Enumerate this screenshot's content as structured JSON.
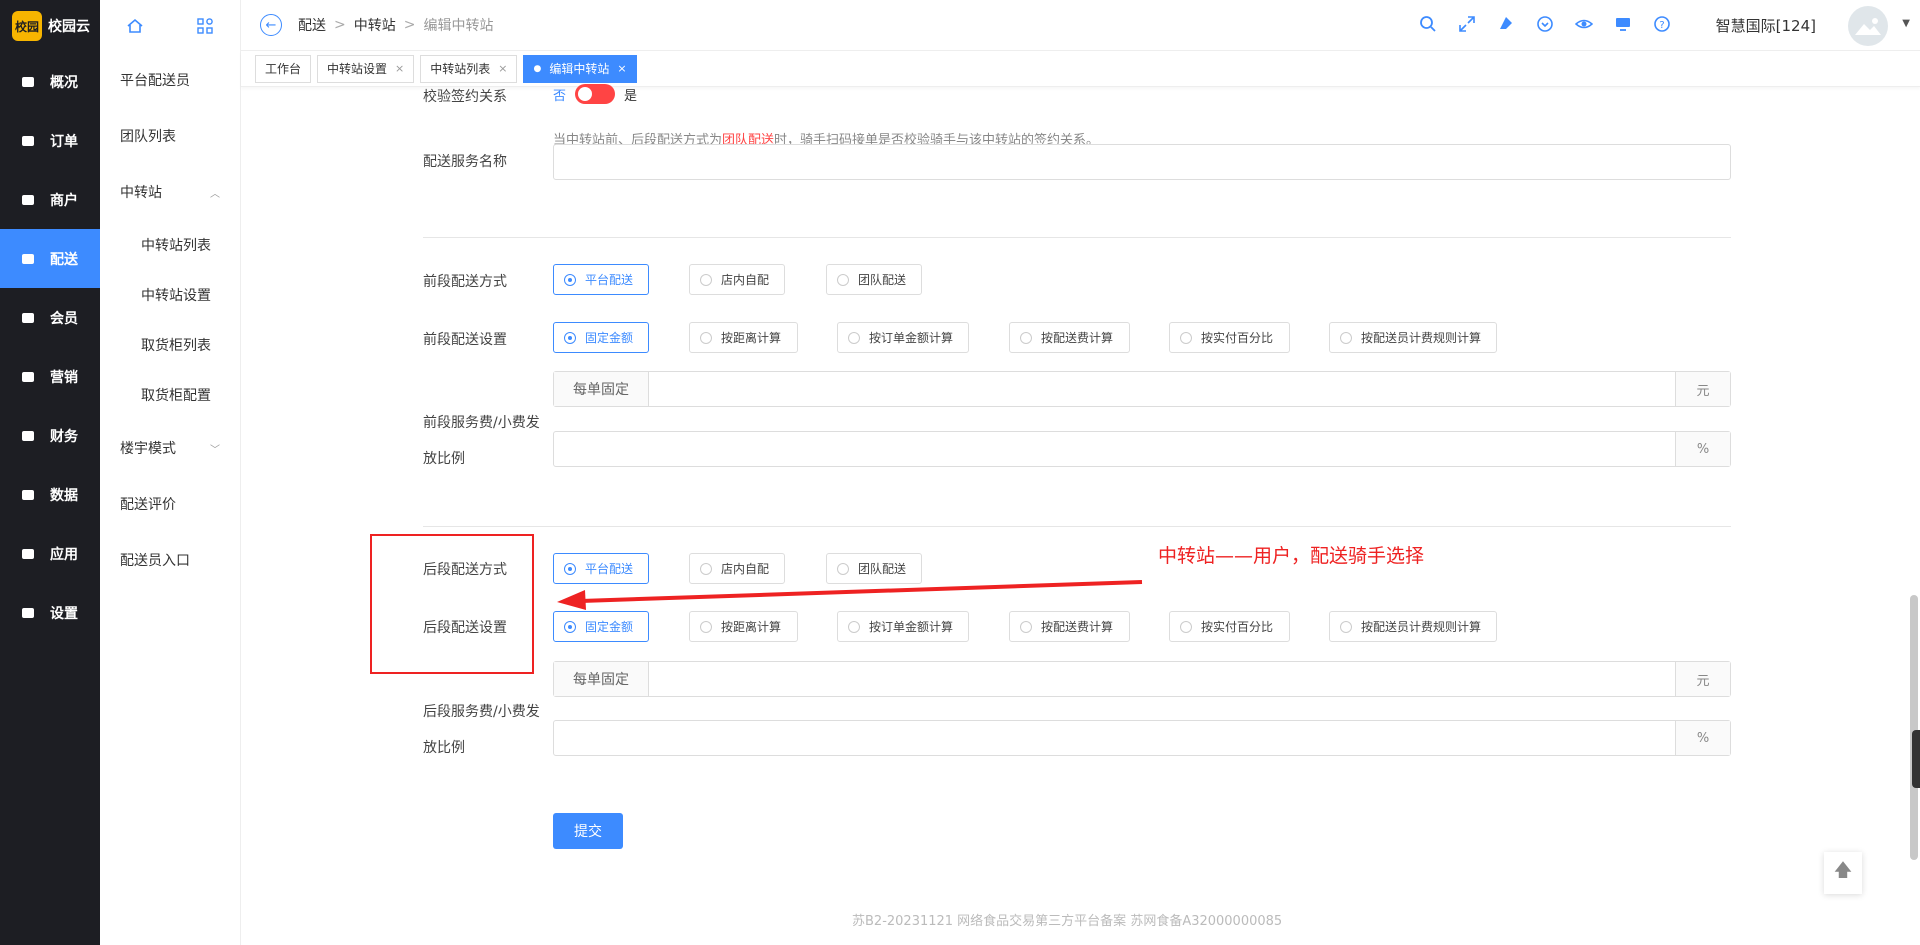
{
  "brand": {
    "badge": "校园",
    "name": "校园云"
  },
  "nav": [
    {
      "label": "概况",
      "icon": "overview-icon"
    },
    {
      "label": "订单",
      "icon": "order-icon"
    },
    {
      "label": "商户",
      "icon": "store-icon"
    },
    {
      "label": "配送",
      "icon": "delivery-icon",
      "active": true
    },
    {
      "label": "会员",
      "icon": "member-icon"
    },
    {
      "label": "营销",
      "icon": "marketing-icon"
    },
    {
      "label": "财务",
      "icon": "finance-icon"
    },
    {
      "label": "数据",
      "icon": "data-icon"
    },
    {
      "label": "应用",
      "icon": "app-icon"
    },
    {
      "label": "设置",
      "icon": "settings-icon"
    }
  ],
  "subnav": {
    "items": [
      "平台配送员",
      "团队列表",
      "中转站",
      "中转站列表",
      "中转站设置",
      "取货柜列表",
      "取货柜配置",
      "楼宇模式",
      "配送评价",
      "配送员入口"
    ]
  },
  "breadcrumb": [
    "配送",
    "中转站",
    "编辑中转站"
  ],
  "user": {
    "name": "智慧国际[124]"
  },
  "tabs": [
    {
      "label": "工作台"
    },
    {
      "label": "中转站设置"
    },
    {
      "label": "中转站列表"
    },
    {
      "label": "编辑中转站",
      "active": true
    }
  ],
  "form": {
    "verify_label": "校验签约关系",
    "switch_no": "否",
    "switch_yes": "是",
    "hint_pre": "当中转站前、后段配送方式为",
    "hint_red": "团队配送",
    "hint_post": "时，骑手扫码接单是否校验骑手与该中转站的签约关系。",
    "service_name_label": "配送服务名称",
    "front_mode_label": "前段配送方式",
    "front_set_label": "前段配送设置",
    "front_fee_label_1": "前段服务费/小费发",
    "front_fee_label_2": "放比例",
    "back_mode_label": "后段配送方式",
    "back_set_label": "后段配送设置",
    "back_fee_label_1": "后段服务费/小费发",
    "back_fee_label_2": "放比例",
    "mode_options": [
      "平台配送",
      "店内自配",
      "团队配送"
    ],
    "set_options": [
      "固定金额",
      "按距离计算",
      "按订单金额计算",
      "按配送费计算",
      "按实付百分比",
      "按配送员计费规则计算"
    ],
    "fixed_prefix": "每单固定",
    "unit_yuan": "元",
    "unit_percent": "%",
    "submit": "提交"
  },
  "annotation": {
    "text": "中转站——用户，配送骑手选择",
    "color": "#e22222"
  },
  "footer": "苏B2-20231121  网络食品交易第三方平台备案 苏网食备A32000000085",
  "colors": {
    "accent": "#3d8bff",
    "nav_bg": "#1d1e23",
    "danger": "#ff4444"
  }
}
